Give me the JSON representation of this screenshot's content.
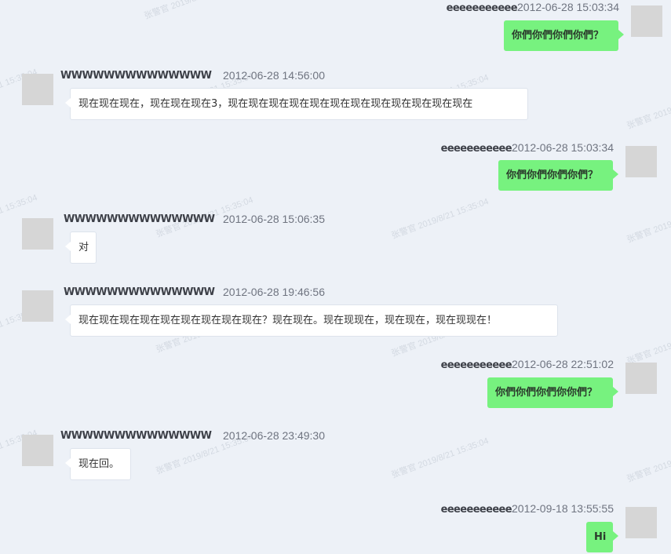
{
  "watermark": "张警官 2019/8/21 15:35:04",
  "messages": [
    {
      "dir": "out",
      "name": "eeeeeeeeeee",
      "time": "2012-06-28 15:03:34",
      "text": "你們你們你們你們？"
    },
    {
      "dir": "in",
      "name": "WWWWWWWWWWWWWW",
      "time": "2012-06-28 14:56:00",
      "text": "现在现在现在，现在现在现在3，现在现在现在现在现在现在现在现在现在现在现在现在"
    },
    {
      "dir": "out",
      "name": "eeeeeeeeeee",
      "time": "2012-06-28 15:03:34",
      "text": "你們你們你們你們？"
    },
    {
      "dir": "in",
      "name": "WWWWWWWWWWWWWW",
      "time": "2012-06-28 15:06:35",
      "text": "对"
    },
    {
      "dir": "in",
      "name": "WWWWWWWWWWWWWW",
      "time": "2012-06-28 19:46:56",
      "text": "现在现在现在现在现在现在现在现在现在？现在现在。现在现现在，现在现在，现在现现在！"
    },
    {
      "dir": "out",
      "name": "eeeeeeeeeee",
      "time": "2012-06-28 22:51:02",
      "text": "你們你們你們你你們？"
    },
    {
      "dir": "in",
      "name": "WWWWWWWWWWWWWW",
      "time": "2012-06-28 23:49:30",
      "text": "现在回。"
    },
    {
      "dir": "out",
      "name": "eeeeeeeeeee",
      "time": "2012-09-18 13:55:55",
      "text": "Hi"
    }
  ]
}
